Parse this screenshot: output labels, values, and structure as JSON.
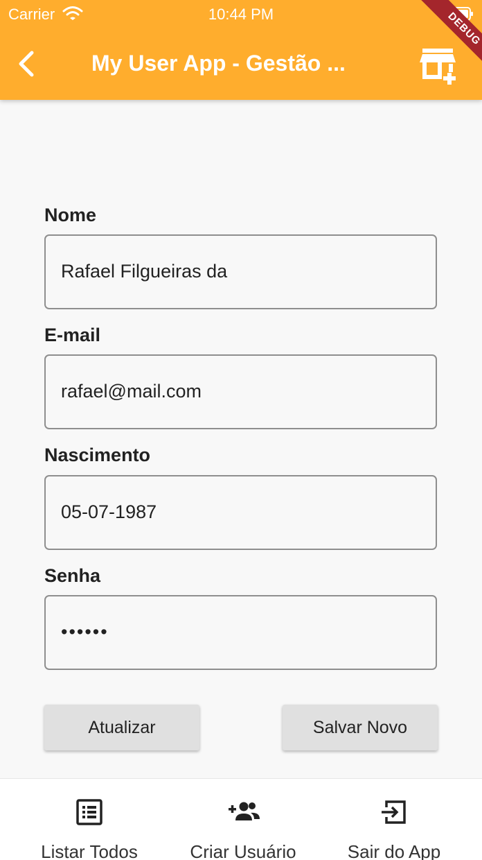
{
  "status_bar": {
    "carrier": "Carrier",
    "time": "10:44 PM"
  },
  "app_bar": {
    "title": "My User App - Gestão ...",
    "debug_banner": "DEBUG",
    "color": "#FFAD2D"
  },
  "form": {
    "name": {
      "label": "Nome",
      "value": "Rafael Filgueiras da"
    },
    "email": {
      "label": "E-mail",
      "value": "rafael@mail.com"
    },
    "birth": {
      "label": "Nascimento",
      "value": "05-07-1987"
    },
    "password": {
      "label": "Senha",
      "value": "••••••"
    }
  },
  "buttons": {
    "update": "Atualizar",
    "save_new": "Salvar Novo"
  },
  "bottom_nav": [
    {
      "label": "Listar Todos",
      "icon": "list-icon"
    },
    {
      "label": "Criar Usuário",
      "icon": "group-add-icon"
    },
    {
      "label": "Sair do App",
      "icon": "exit-icon"
    }
  ]
}
